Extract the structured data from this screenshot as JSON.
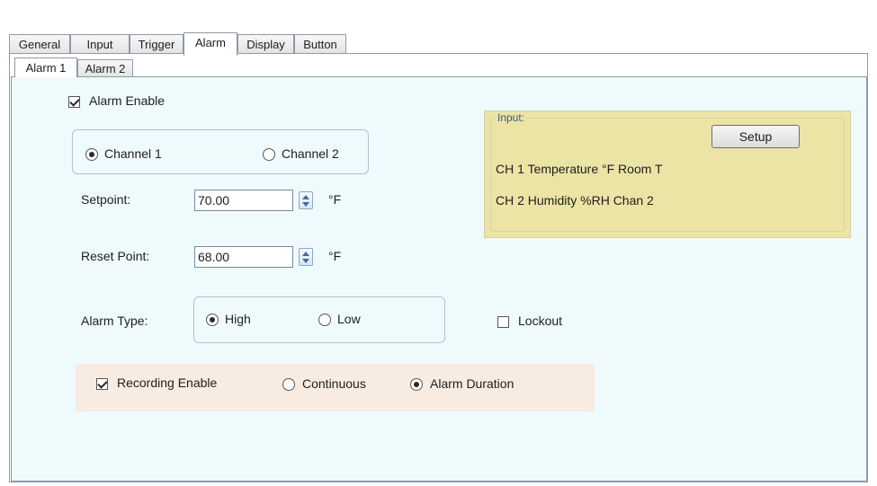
{
  "tabs": [
    "General",
    "Input",
    "Trigger",
    "Alarm",
    "Display",
    "Button"
  ],
  "active_tab": "Alarm",
  "subtabs": [
    "Alarm 1",
    "Alarm 2"
  ],
  "active_subtab": "Alarm 1",
  "alarm_enable": {
    "label": "Alarm Enable",
    "checked": true
  },
  "channel": {
    "options": [
      "Channel 1",
      "Channel 2"
    ],
    "selected": "Channel 1"
  },
  "setpoint": {
    "label": "Setpoint:",
    "value": "70.00",
    "unit": "°F"
  },
  "reset_point": {
    "label": "Reset Point:",
    "value": "68.00",
    "unit": "°F"
  },
  "alarm_type": {
    "label": "Alarm Type:",
    "options": [
      "High",
      "Low"
    ],
    "selected": "High"
  },
  "lockout": {
    "label": "Lockout",
    "checked": false
  },
  "recording": {
    "enable_label": "Recording Enable",
    "enabled": true,
    "options": [
      "Continuous",
      "Alarm Duration"
    ],
    "selected": "Alarm Duration"
  },
  "input_panel": {
    "legend": "Input:",
    "setup_label": "Setup",
    "ch1": "CH 1 Temperature °F  Room T",
    "ch2": "CH 2 Humidity %RH  Chan 2"
  }
}
